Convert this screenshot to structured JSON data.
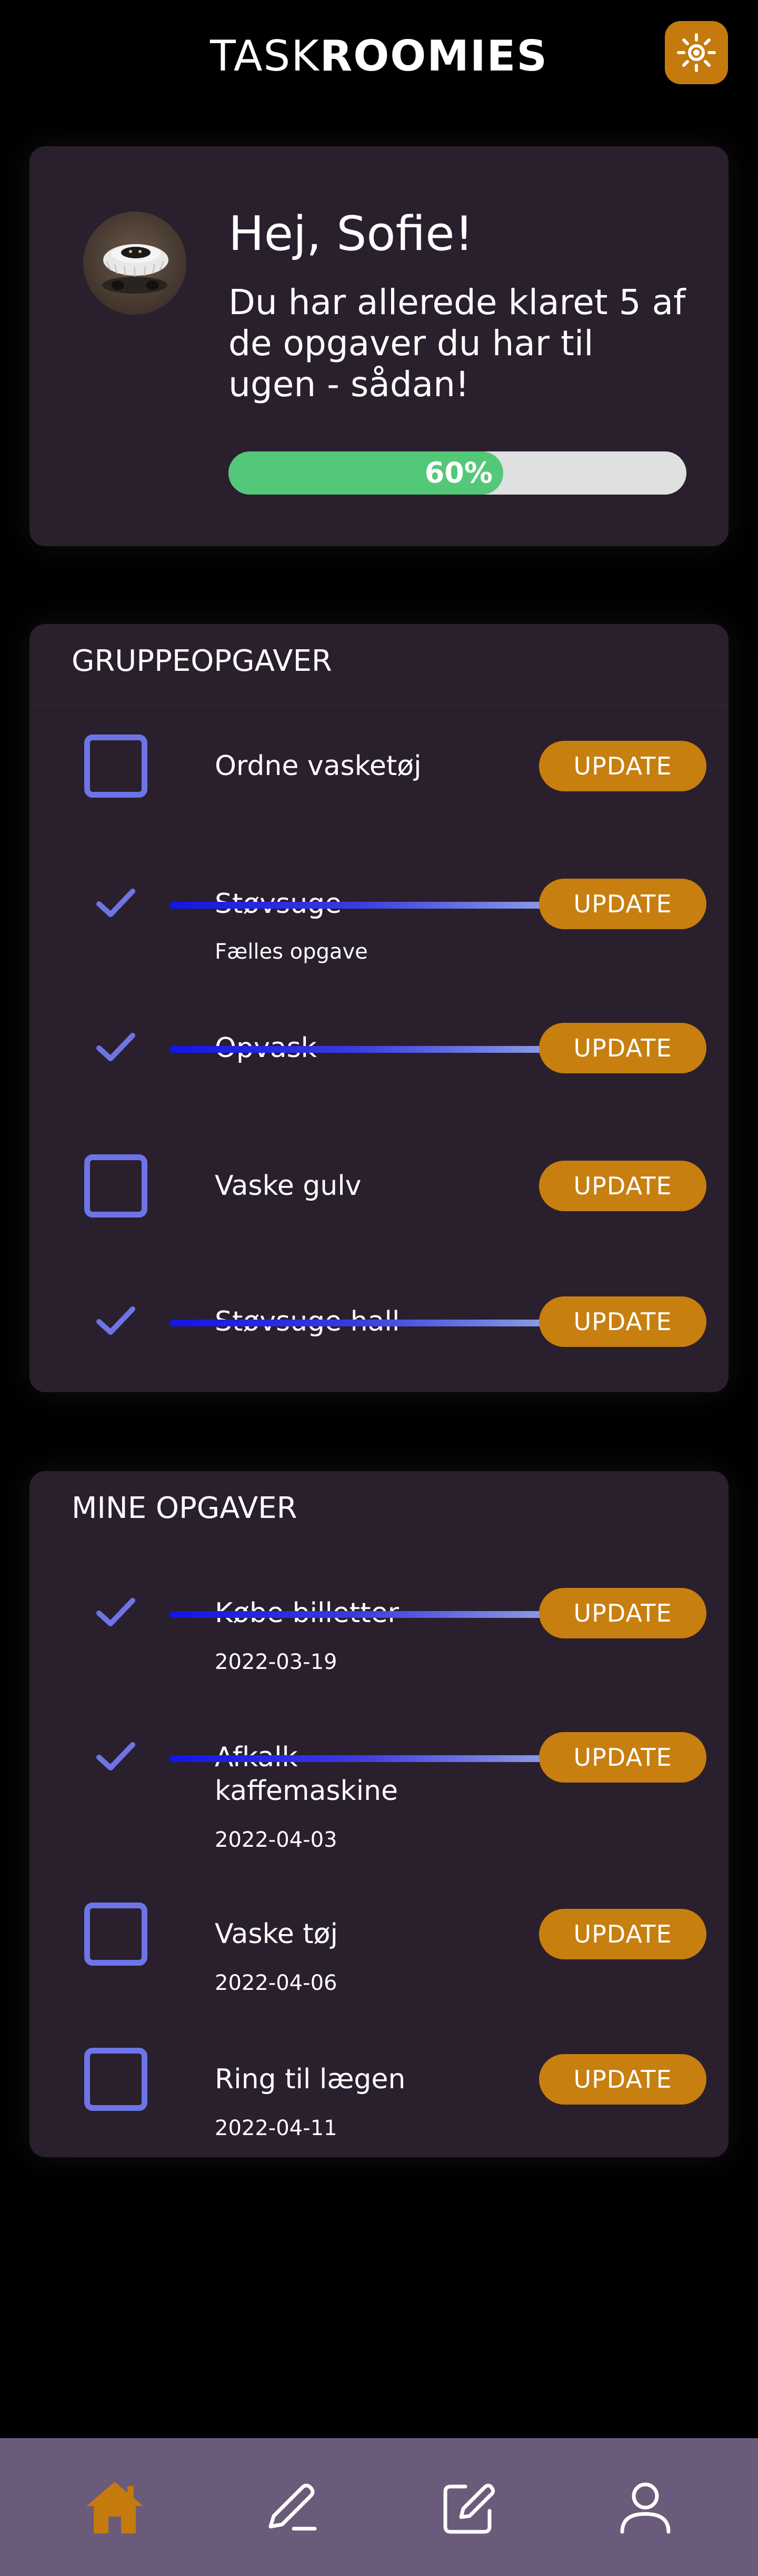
{
  "app": {
    "logo_light": "TASK",
    "logo_bold": "ROOMIES"
  },
  "welcome": {
    "greeting": "Hej, Sofie!",
    "message": "Du har allerede klaret 5 af de opgaver du har til ugen - sådan!",
    "progress_label": "60%",
    "progress_value": 0.6
  },
  "group_tasks": {
    "title": "GRUPPEOPGAVER",
    "items": [
      {
        "title": "Ordne vasketøj",
        "subtitle": "",
        "done": false,
        "update_label": "UPDATE"
      },
      {
        "title": "Støvsuge",
        "subtitle": "Fælles opgave",
        "done": true,
        "update_label": "UPDATE"
      },
      {
        "title": "Opvask",
        "subtitle": "",
        "done": true,
        "update_label": "UPDATE"
      },
      {
        "title": "Vaske gulv",
        "subtitle": "",
        "done": false,
        "update_label": "UPDATE"
      },
      {
        "title": "Støvsuge hall",
        "subtitle": "",
        "done": true,
        "update_label": "UPDATE"
      }
    ]
  },
  "my_tasks": {
    "title": "MINE OPGAVER",
    "items": [
      {
        "title": "Købe billetter",
        "date": "2022-03-19",
        "done": true,
        "update_label": "UPDATE"
      },
      {
        "title": "Afkalk kaffemaskine",
        "date": "2022-04-03",
        "done": true,
        "update_label": "UPDATE"
      },
      {
        "title": "Vaske tøj",
        "date": "2022-04-06",
        "done": false,
        "update_label": "UPDATE"
      },
      {
        "title": "Ring til lægen",
        "date": "2022-04-11",
        "done": false,
        "update_label": "UPDATE"
      }
    ]
  },
  "nav": {
    "items": [
      {
        "icon": "home-icon",
        "active": true
      },
      {
        "icon": "pen-icon",
        "active": false
      },
      {
        "icon": "edit-square-icon",
        "active": false
      },
      {
        "icon": "user-icon",
        "active": false
      }
    ]
  },
  "colors": {
    "accent": "#c77f10",
    "card": "#2a1f2c",
    "progress": "#53c878",
    "checkbox": "#6d75e6",
    "nav_bg": "#6b5b7a",
    "nav_active": "#c47a0c"
  }
}
